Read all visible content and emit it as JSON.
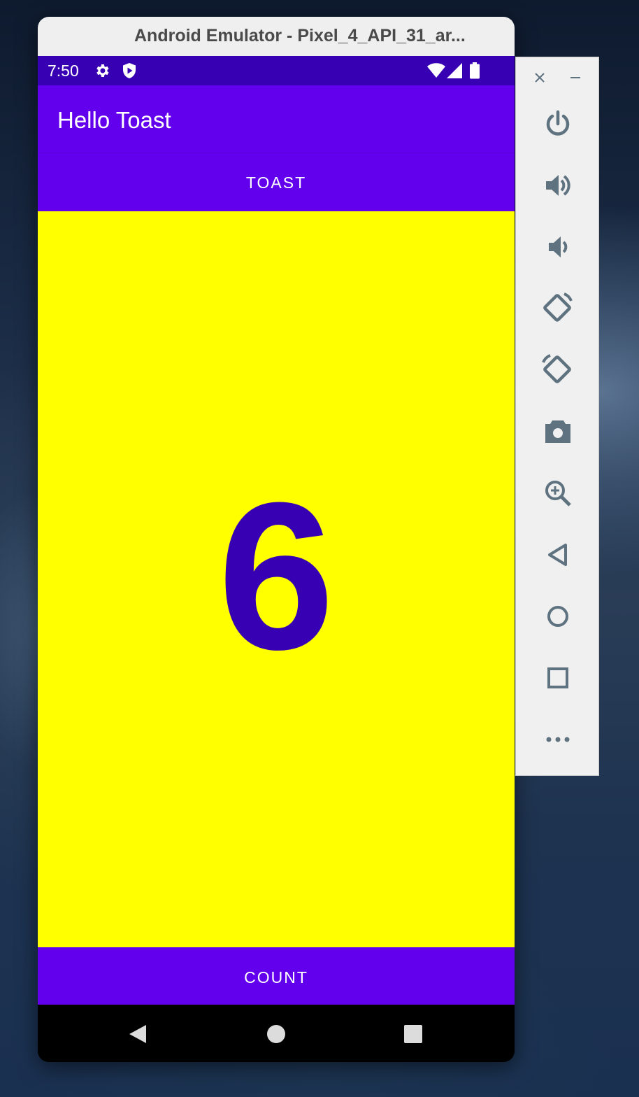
{
  "window": {
    "title": "Android Emulator - Pixel_4_API_31_ar..."
  },
  "status_bar": {
    "time": "7:50",
    "icons": [
      "gear-icon",
      "shield-icon",
      "wifi-icon",
      "signal-icon",
      "battery-icon"
    ]
  },
  "app": {
    "title": "Hello Toast",
    "toast_label": "TOAST",
    "count_value": "6",
    "count_label": "COUNT"
  },
  "nav_bar": {
    "buttons": [
      "back-icon",
      "home-icon",
      "recents-icon"
    ]
  },
  "side_toolbar": {
    "controls": [
      "close-icon",
      "minimize-icon"
    ],
    "tools": [
      "power-icon",
      "volume-up-icon",
      "volume-down-icon",
      "rotate-left-icon",
      "rotate-right-icon",
      "camera-icon",
      "zoom-icon",
      "back-icon",
      "home-icon",
      "overview-icon",
      "more-icon"
    ]
  },
  "colors": {
    "status_bar": "#3700b3",
    "primary": "#6200ee",
    "count_background": "#ffff00",
    "count_text": "#3700b3",
    "toolbar_icon": "#5f7280"
  }
}
